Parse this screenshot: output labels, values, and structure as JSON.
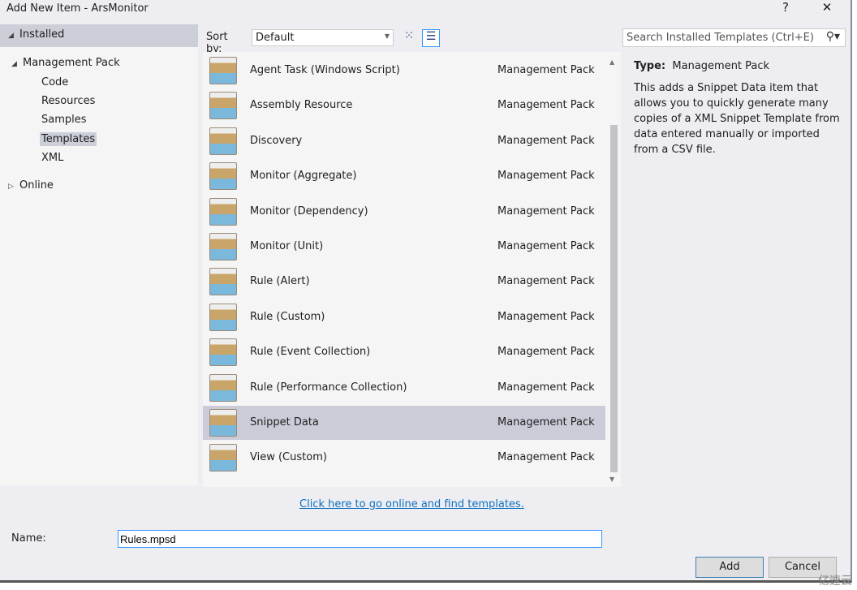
{
  "window": {
    "title": "Add New Item - ArsMonitor",
    "help": "?",
    "close": "✕"
  },
  "sidebar": {
    "installed": "Installed",
    "management_pack": "Management Pack",
    "children": [
      "Code",
      "Resources",
      "Samples",
      "Templates",
      "XML"
    ],
    "selected": "Templates",
    "online": "Online"
  },
  "toolbar": {
    "sort_label": "Sort by:",
    "sort_value": "Default",
    "grid_view_icon": "small-icons-view",
    "list_view_icon": "details-view"
  },
  "search": {
    "placeholder": "Search Installed Templates (Ctrl+E)"
  },
  "templates": [
    {
      "name": "Agent Task (Windows Script)",
      "type": "Management Pack"
    },
    {
      "name": "Assembly Resource",
      "type": "Management Pack"
    },
    {
      "name": "Discovery",
      "type": "Management Pack"
    },
    {
      "name": "Monitor (Aggregate)",
      "type": "Management Pack"
    },
    {
      "name": "Monitor (Dependency)",
      "type": "Management Pack"
    },
    {
      "name": "Monitor (Unit)",
      "type": "Management Pack"
    },
    {
      "name": "Rule (Alert)",
      "type": "Management Pack"
    },
    {
      "name": "Rule (Custom)",
      "type": "Management Pack"
    },
    {
      "name": "Rule (Event Collection)",
      "type": "Management Pack"
    },
    {
      "name": "Rule (Performance Collection)",
      "type": "Management Pack"
    },
    {
      "name": "Snippet Data",
      "type": "Management Pack"
    },
    {
      "name": "View (Custom)",
      "type": "Management Pack"
    }
  ],
  "selected_template": "Snippet Data",
  "details": {
    "type_label": "Type:",
    "type_value": "Management Pack",
    "description": "This adds a Snippet Data item that allows you to quickly generate many copies of a XML Snippet Template from data entered manually or imported from a CSV file."
  },
  "online_link": "Click here to go online and find templates.",
  "name_label": "Name:",
  "name_value": "Rules.mpsd",
  "buttons": {
    "add": "Add",
    "cancel": "Cancel"
  },
  "watermark": "亿速云"
}
